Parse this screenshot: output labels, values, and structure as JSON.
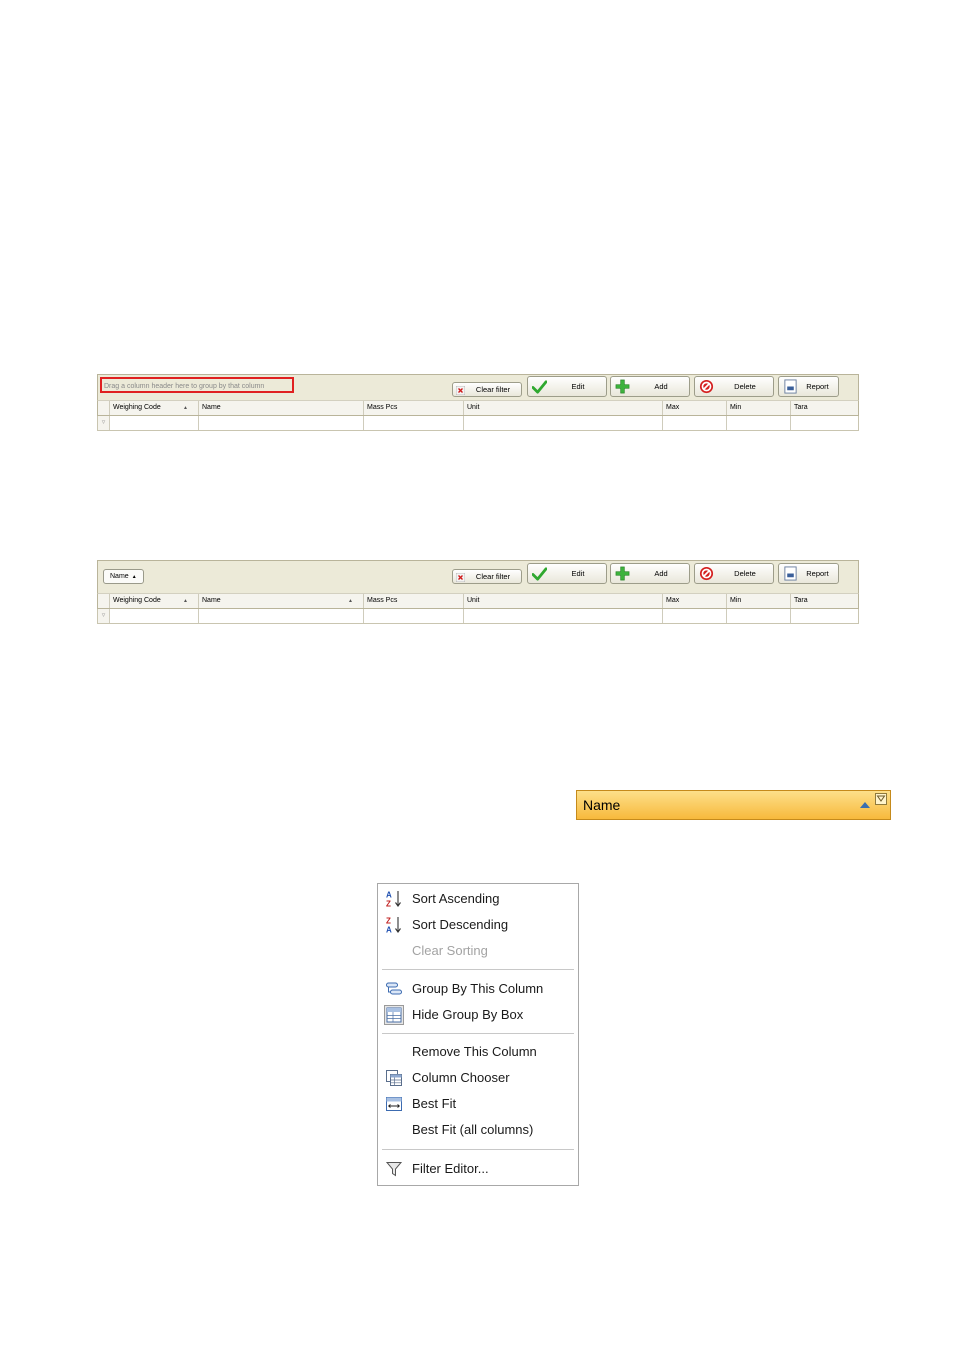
{
  "grid_top": {
    "group_hint": "Drag a column header here to group by that column",
    "buttons": {
      "clear_filter": "Clear filter",
      "edit": "Edit",
      "add": "Add",
      "delete": "Delete",
      "report": "Report"
    },
    "columns": [
      "Weighing Code",
      "Name",
      "Mass Pcs",
      "Unit",
      "Max",
      "Min",
      "Tara"
    ]
  },
  "grid_bottom": {
    "group_chip": "Name",
    "buttons": {
      "clear_filter": "Clear filter",
      "edit": "Edit",
      "add": "Add",
      "delete": "Delete",
      "report": "Report"
    },
    "columns": [
      "Weighing Code",
      "Name",
      "Mass Pcs",
      "Unit",
      "Max",
      "Min",
      "Tara"
    ]
  },
  "column_header": {
    "label": "Name"
  },
  "context_menu": {
    "items": [
      {
        "label": "Sort Ascending",
        "icon": "sort-ascending-icon",
        "enabled": true
      },
      {
        "label": "Sort Descending",
        "icon": "sort-descending-icon",
        "enabled": true
      },
      {
        "label": "Clear Sorting",
        "icon": "",
        "enabled": false
      },
      {
        "label": "Group By This Column",
        "icon": "group-by-icon",
        "enabled": true
      },
      {
        "label": "Hide Group By Box",
        "icon": "group-box-icon",
        "enabled": true
      },
      {
        "label": "Remove This Column",
        "icon": "",
        "enabled": true
      },
      {
        "label": "Column Chooser",
        "icon": "column-chooser-icon",
        "enabled": true
      },
      {
        "label": "Best Fit",
        "icon": "best-fit-icon",
        "enabled": true
      },
      {
        "label": "Best Fit (all columns)",
        "icon": "",
        "enabled": true
      },
      {
        "label": "Filter Editor...",
        "icon": "filter-icon",
        "enabled": true
      }
    ]
  },
  "colors": {
    "header_highlight": "#f7b93c",
    "group_hint_border": "#e02020",
    "toolbar_bg": "#ecead8"
  }
}
